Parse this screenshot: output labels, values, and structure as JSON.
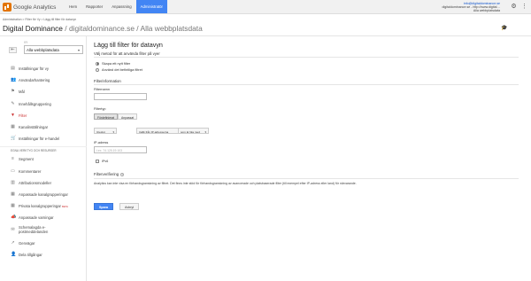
{
  "app": {
    "name": "Google Analytics"
  },
  "nav": {
    "items": [
      {
        "label": "Hem"
      },
      {
        "label": "Rapporter"
      },
      {
        "label": "Anpassning"
      },
      {
        "label": "Administratör"
      }
    ],
    "active_index": 3
  },
  "account": {
    "email": "info@digitaldominance.se",
    "line2": "digitaldominance.se - http://www.digital…",
    "line3": "Alla webbplatsdata"
  },
  "breadcrumb": "Administration > Filter för Vy > Lägg till filter för datavyn",
  "header": {
    "title": "Digital Dominance",
    "subtitle": " / digitaldominance.se / Alla webbplatsdata"
  },
  "sidebar": {
    "back_icon": "back-arrow-icon",
    "view_label": "VY",
    "view_select": "Alla webbplatsdata",
    "items": [
      {
        "label": "Inställningar för vy",
        "icon": "doc-icon"
      },
      {
        "label": "Användarhantering",
        "icon": "users-icon"
      },
      {
        "label": "Mål",
        "icon": "flag-icon"
      },
      {
        "label": "Innehållsgruppering",
        "icon": "grouping-icon"
      },
      {
        "label": "Filter",
        "icon": "filter-icon",
        "active": true
      },
      {
        "label": "Kanalinställningar",
        "icon": "channel-icon"
      },
      {
        "label": "Inställningar för e-handel",
        "icon": "cart-icon"
      }
    ],
    "section_label": "EGNA VERKTYG OCH RESURSER",
    "tools": [
      {
        "label": "Segment",
        "icon": "segment-icon"
      },
      {
        "label": "Kommentarer",
        "icon": "comment-icon"
      },
      {
        "label": "Attributionsmodeller",
        "icon": "attribution-icon"
      },
      {
        "label": "Anpassade kanalgrupperingar",
        "icon": "channel-group-icon"
      },
      {
        "label": "Privata kanalgrupperingar",
        "icon": "private-channel-icon",
        "badge": "BETA"
      },
      {
        "label": "Anpassade varningar",
        "icon": "alert-icon"
      },
      {
        "label": "Schemalagda e-postmeddelanden",
        "icon": "mail-icon"
      },
      {
        "label": "Genvägar",
        "icon": "shortcut-icon"
      },
      {
        "label": "Dela tillgångar",
        "icon": "share-icon"
      }
    ]
  },
  "form": {
    "heading": "Lägg till filter för datavyn",
    "method_label": "Välj metod för att använda filter på vyer",
    "radio_new": "Skapa ett nytt filter",
    "radio_existing": "Använd det befintliga filtret",
    "info_label": "Filterinformation",
    "name_label": "Filternamn",
    "name_value": "",
    "type_label": "Filtertyp",
    "type_predefined": "Fördefinierat",
    "type_custom": "Anpassat",
    "select_exclude": "Uteslut",
    "select_traffic": "trafik från IP-adresserna",
    "select_equal": "som är lika med",
    "ip_label": "IP-adress",
    "ip_placeholder": "t.ex. 74.125.19.103",
    "ipv6_label": "IPv6",
    "verify_label": "Filterverifiering",
    "verify_desc": "Analytics kan inte visa en förhandsgranskning av filtret. Det finns inte stöd för förhandsgranskning av avancerade och platsbaserade filter (till exempel efter IP-adress eller land) för närvarande.",
    "save_button": "Spara",
    "cancel_button": "Avbryt"
  },
  "colors": {
    "accent": "#4285f4",
    "active_menu": "#cc3333"
  }
}
